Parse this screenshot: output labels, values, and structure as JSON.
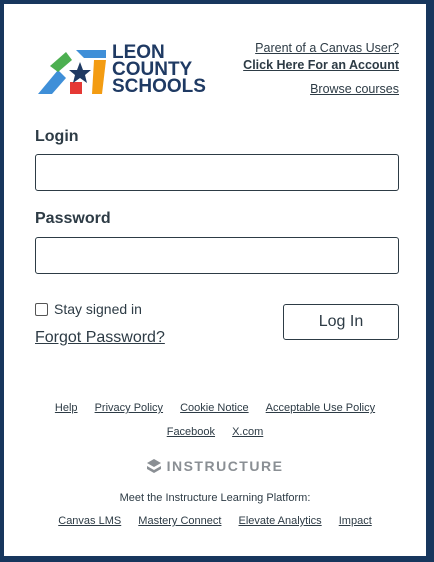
{
  "logo": {
    "lines": [
      "LEON",
      "COUNTY",
      "SCHOOLS"
    ]
  },
  "top_links": {
    "parent_prompt": "Parent of a Canvas User?",
    "create_account": "Click Here For an Account",
    "browse_courses": "Browse courses"
  },
  "form": {
    "login_label": "Login",
    "login_value": "",
    "password_label": "Password",
    "password_value": "",
    "stay_signed_in": "Stay signed in",
    "forgot_password": "Forgot Password?",
    "login_button": "Log In"
  },
  "footer": {
    "links_row1": [
      "Help",
      "Privacy Policy",
      "Cookie Notice",
      "Acceptable Use Policy"
    ],
    "links_row2": [
      "Facebook",
      "X.com"
    ],
    "brand": "INSTRUCTURE",
    "meet": "Meet the Instructure Learning Platform:",
    "platform_links": [
      "Canvas LMS",
      "Mastery Connect",
      "Elevate Analytics",
      "Impact"
    ]
  },
  "colors": {
    "frame": "#17365d",
    "text": "#2d3b45",
    "logo_blue": "#1f3a63",
    "logo_green": "#4caf50",
    "logo_red": "#e53935",
    "logo_orange": "#f39c12",
    "logo_lightblue": "#3f8fd8"
  }
}
